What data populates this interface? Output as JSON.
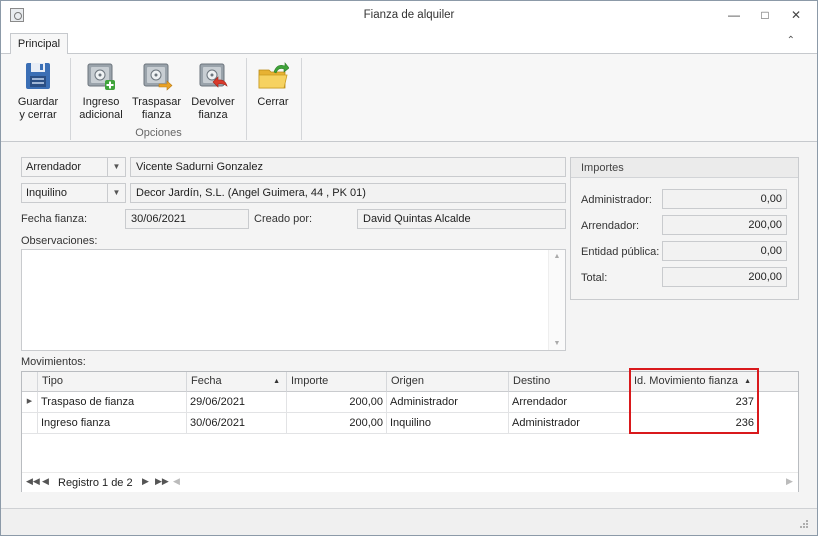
{
  "window": {
    "title": "Fianza de alquiler",
    "controls": {
      "minimize": "—",
      "maximize": "□",
      "close": "✕"
    }
  },
  "ribbon": {
    "tab_label": "Principal",
    "buttons": {
      "save": [
        "Guardar",
        "y cerrar"
      ],
      "ingreso": [
        "Ingreso",
        "adicional"
      ],
      "traspasar": [
        "Traspasar",
        "fianza"
      ],
      "devolver": [
        "Devolver",
        "fianza"
      ],
      "cerrar": [
        "Cerrar",
        ""
      ]
    },
    "group_label": "Opciones"
  },
  "form": {
    "role1": {
      "value": "Arrendador",
      "name": "Vicente Sadurni Gonzalez"
    },
    "role2": {
      "value": "Inquilino",
      "name": "Decor Jardín, S.L. (Angel Guimera, 44 , PK 01)"
    },
    "fecha_label": "Fecha fianza:",
    "fecha_value": "30/06/2021",
    "creado_label": "Creado por:",
    "creado_value": "David Quintas Alcalde",
    "observaciones_label": "Observaciones:",
    "observaciones_value": ""
  },
  "importes": {
    "title": "Importes",
    "rows": [
      {
        "label": "Administrador:",
        "value": "0,00"
      },
      {
        "label": "Arrendador:",
        "value": "200,00"
      },
      {
        "label": "Entidad pública:",
        "value": "0,00"
      },
      {
        "label": "Total:",
        "value": "200,00"
      }
    ]
  },
  "movimientos": {
    "label": "Movimientos:",
    "columns": [
      "Tipo",
      "Fecha",
      "Importe",
      "Origen",
      "Destino",
      "Id. Movimiento fianza"
    ],
    "rows": [
      {
        "tipo": "Traspaso de fianza",
        "fecha": "29/06/2021",
        "importe": "200,00",
        "origen": "Administrador",
        "destino": "Arrendador",
        "id": "237"
      },
      {
        "tipo": "Ingreso fianza",
        "fecha": "30/06/2021",
        "importe": "200,00",
        "origen": "Inquilino",
        "destino": "Administrador",
        "id": "236"
      }
    ],
    "record_text": "Registro 1 de 2"
  },
  "colors": {
    "highlight": "#d9191c",
    "accent_green": "#3fa33a"
  }
}
